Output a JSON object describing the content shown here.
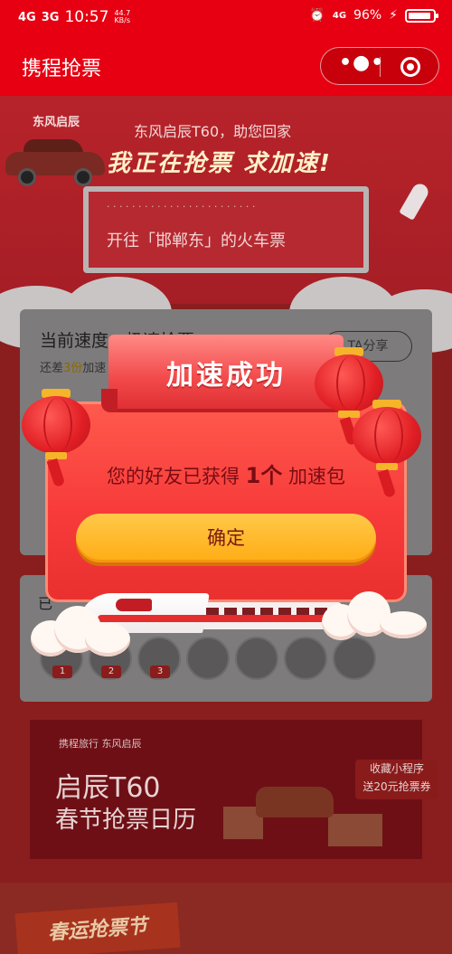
{
  "status_bar": {
    "network1": "4G",
    "network2": "3G",
    "time": "10:57",
    "speed_value": "44.7",
    "speed_unit": "KB/s",
    "network3": "4G",
    "battery": "96%"
  },
  "navbar": {
    "title": "携程抢票",
    "menu_icon": "more-dots-icon",
    "close_icon": "target-icon"
  },
  "banner": {
    "brand": "东风启辰",
    "subtitle": "东风启辰T60，助您回家",
    "title": "我正在抢票 求加速!",
    "ticket_label": "开往「邯郸东」的火车票"
  },
  "speed_card": {
    "label": "当前速度：极速抢票",
    "sub_prefix": "还差",
    "sub_value": "3份",
    "sub_suffix": "加速",
    "share_button": "TA分享"
  },
  "friends": {
    "label": "已",
    "avatars": [
      {
        "rank": "1"
      },
      {
        "rank": "2"
      },
      {
        "rank": "3"
      },
      {
        "rank": ""
      },
      {
        "rank": ""
      },
      {
        "rank": ""
      },
      {
        "rank": ""
      }
    ]
  },
  "ad": {
    "brand": "携程旅行  东风启辰",
    "line1": "启辰T60",
    "line2": "春节抢票日历",
    "badge_line1": "收藏小程序",
    "badge_line2": "送20元抢票券"
  },
  "bottom_banner": {
    "title": "春运抢票节"
  },
  "modal": {
    "title": "加速成功",
    "message_prefix": "您的好友已获得",
    "message_count": "1个",
    "message_suffix": "加速包",
    "confirm_button": "确定"
  },
  "colors": {
    "nav_red": "#e60012",
    "confirm_orange": "#ffac14",
    "modal_red": "#f73b3a"
  }
}
